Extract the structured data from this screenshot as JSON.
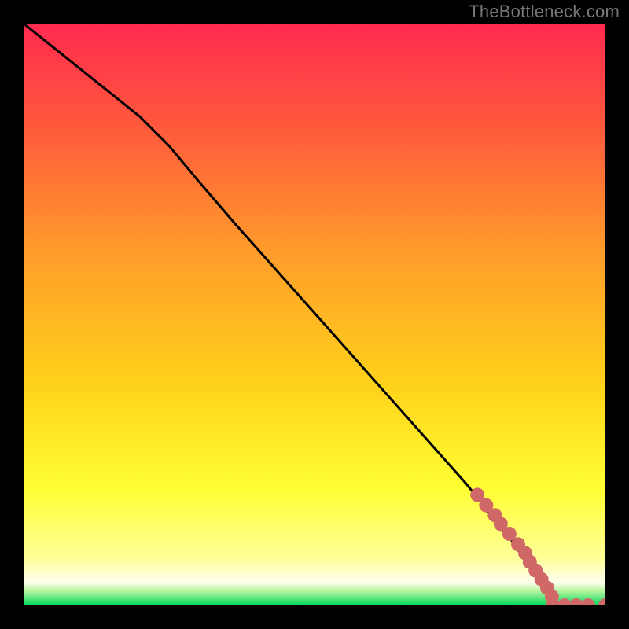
{
  "watermark": "TheBottleneck.com",
  "chart_data": {
    "type": "line",
    "title": "",
    "xlabel": "",
    "ylabel": "",
    "xlim": [
      0,
      100
    ],
    "ylim": [
      0,
      100
    ],
    "grid": false,
    "background_gradient": {
      "top": "#ff2a4f",
      "mid_upper": "#ffd200",
      "mid_lower": "#ffff7a",
      "bottom": "#00e060"
    },
    "series": [
      {
        "name": "curve",
        "type": "line",
        "color": "#000000",
        "x": [
          0,
          5,
          10,
          15,
          20,
          25,
          30,
          36,
          44,
          52,
          60,
          68,
          76,
          80,
          84,
          86,
          88,
          90,
          91
        ],
        "y": [
          100,
          96,
          92,
          88,
          84,
          79,
          73,
          66,
          57,
          48,
          39,
          30,
          21,
          16,
          11,
          8,
          5,
          2,
          0
        ]
      },
      {
        "name": "dots-on-slope",
        "type": "scatter",
        "color": "#d06868",
        "size": 9,
        "x": [
          78,
          79.5,
          81,
          82,
          83.5,
          85,
          86.2,
          87,
          88,
          89,
          90,
          90.8
        ],
        "y": [
          19,
          17.2,
          15.5,
          14,
          12.3,
          10.5,
          9,
          7.5,
          6,
          4.5,
          3,
          1.5
        ]
      },
      {
        "name": "dots-on-floor",
        "type": "scatter",
        "color": "#d06868",
        "size": 9,
        "x": [
          91,
          93,
          95,
          97,
          100
        ],
        "y": [
          0,
          0,
          0,
          0,
          0
        ]
      }
    ]
  }
}
